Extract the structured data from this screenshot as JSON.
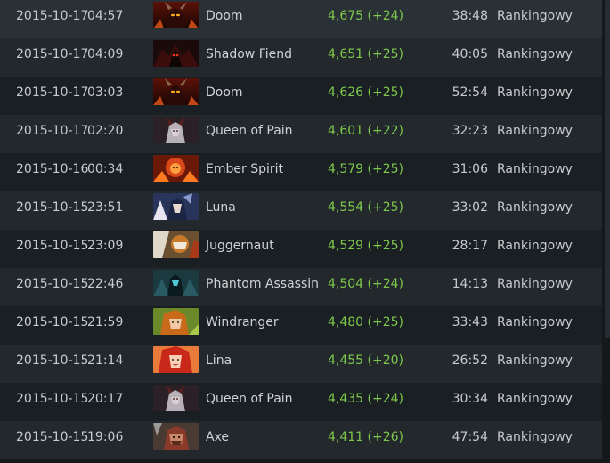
{
  "matches": [
    {
      "date": "2015-10-17",
      "time": "04:57",
      "hero": "Doom",
      "hero_icon": "doom-portrait-icon",
      "mmr": "4,675 (+24)",
      "duration": "38:48",
      "type": "Rankingowy"
    },
    {
      "date": "2015-10-17",
      "time": "04:09",
      "hero": "Shadow Fiend",
      "hero_icon": "shadow-fiend-portrait-icon",
      "mmr": "4,651 (+25)",
      "duration": "40:05",
      "type": "Rankingowy"
    },
    {
      "date": "2015-10-17",
      "time": "03:03",
      "hero": "Doom",
      "hero_icon": "doom-portrait-icon",
      "mmr": "4,626 (+25)",
      "duration": "52:54",
      "type": "Rankingowy"
    },
    {
      "date": "2015-10-17",
      "time": "02:20",
      "hero": "Queen of Pain",
      "hero_icon": "queen-of-pain-portrait-icon",
      "mmr": "4,601 (+22)",
      "duration": "32:23",
      "type": "Rankingowy"
    },
    {
      "date": "2015-10-16",
      "time": "00:34",
      "hero": "Ember Spirit",
      "hero_icon": "ember-spirit-portrait-icon",
      "mmr": "4,579 (+25)",
      "duration": "31:06",
      "type": "Rankingowy"
    },
    {
      "date": "2015-10-15",
      "time": "23:51",
      "hero": "Luna",
      "hero_icon": "luna-portrait-icon",
      "mmr": "4,554 (+25)",
      "duration": "33:02",
      "type": "Rankingowy"
    },
    {
      "date": "2015-10-15",
      "time": "23:09",
      "hero": "Juggernaut",
      "hero_icon": "juggernaut-portrait-icon",
      "mmr": "4,529 (+25)",
      "duration": "28:17",
      "type": "Rankingowy"
    },
    {
      "date": "2015-10-15",
      "time": "22:46",
      "hero": "Phantom Assassin",
      "hero_icon": "phantom-assassin-portrait-icon",
      "mmr": "4,504 (+24)",
      "duration": "14:13",
      "type": "Rankingowy"
    },
    {
      "date": "2015-10-15",
      "time": "21:59",
      "hero": "Windranger",
      "hero_icon": "windranger-portrait-icon",
      "mmr": "4,480 (+25)",
      "duration": "33:43",
      "type": "Rankingowy"
    },
    {
      "date": "2015-10-15",
      "time": "21:14",
      "hero": "Lina",
      "hero_icon": "lina-portrait-icon",
      "mmr": "4,455 (+20)",
      "duration": "26:52",
      "type": "Rankingowy"
    },
    {
      "date": "2015-10-15",
      "time": "20:17",
      "hero": "Queen of Pain",
      "hero_icon": "queen-of-pain-portrait-icon",
      "mmr": "4,435 (+24)",
      "duration": "30:34",
      "type": "Rankingowy"
    },
    {
      "date": "2015-10-15",
      "time": "19:06",
      "hero": "Axe",
      "hero_icon": "axe-portrait-icon",
      "mmr": "4,411 (+26)",
      "duration": "47:54",
      "type": "Rankingowy"
    }
  ],
  "colors": {
    "background": "#14181b",
    "row_odd": "#1a1f23",
    "row_even": "#22282c",
    "mmr_gain": "#7ec84b",
    "text": "#c8cbce"
  }
}
